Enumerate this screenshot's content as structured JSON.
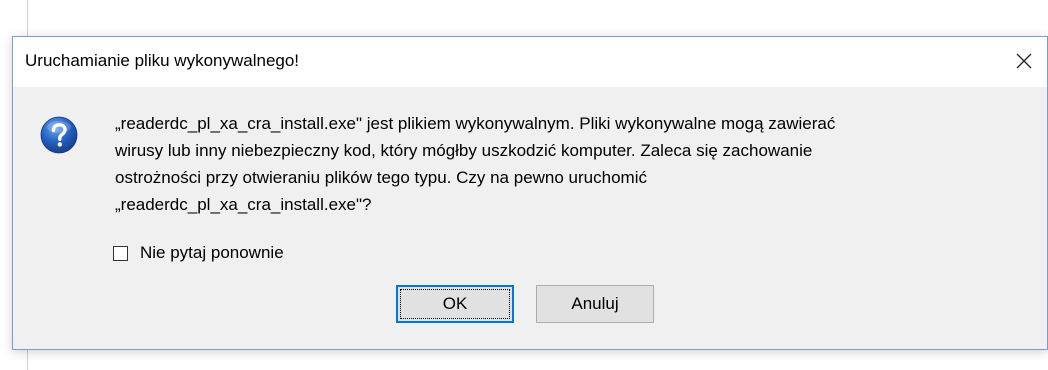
{
  "dialog": {
    "title": "Uruchamianie pliku wykonywalnego!",
    "close_icon": "close-icon",
    "question_icon": "question-icon",
    "message_lines": [
      "„readerdc_pl_xa_cra_install.exe\" jest plikiem wykonywalnym. Pliki wykonywalne mogą zawierać",
      "wirusy lub inny niebezpieczny kod, który mógłby uszkodzić komputer. Zaleca się zachowanie",
      "ostrożności przy otwieraniu plików tego typu. Czy na pewno uruchomić",
      "„readerdc_pl_xa_cra_install.exe\"?"
    ],
    "checkbox": {
      "label": "Nie pytaj ponownie",
      "checked": false
    },
    "buttons": {
      "ok_label": "OK",
      "cancel_label": "Anuluj"
    },
    "colors": {
      "accent": "#0078d7",
      "icon_blue": "#1f5fb4",
      "border": "#7a9cd3"
    }
  }
}
